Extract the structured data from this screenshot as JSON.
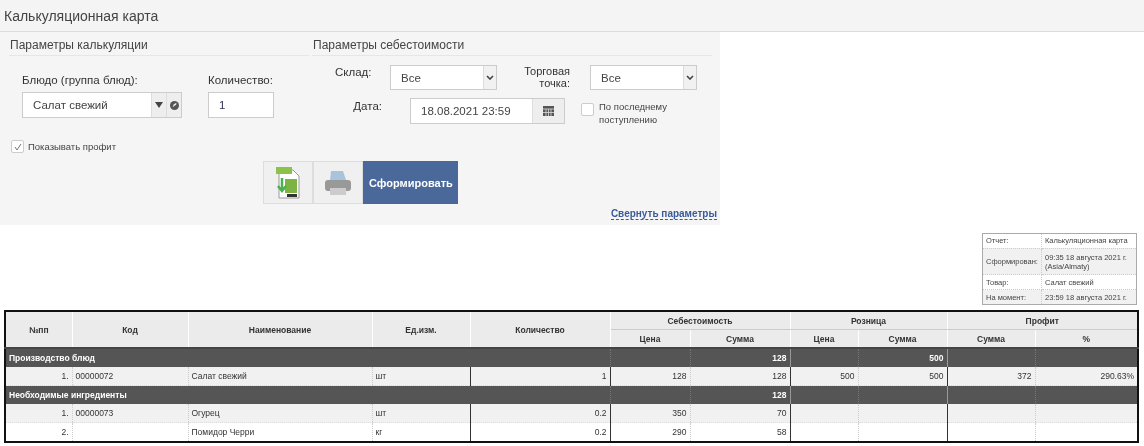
{
  "title": "Калькуляционная карта",
  "calc_params": {
    "heading": "Параметры калькуляции",
    "dish": {
      "label": "Блюдо (группа блюд):",
      "value": "Салат свежий"
    },
    "quantity": {
      "label": "Количество:",
      "value": "1"
    },
    "show_profit": {
      "label": "Показывать профит",
      "checked": true
    }
  },
  "cost_params": {
    "heading": "Параметры себестоимости",
    "warehouse": {
      "label": "Склад:",
      "value": "Все"
    },
    "outlet": {
      "label": "Торговая точка:",
      "value": "Все"
    },
    "date": {
      "label": "Дата:",
      "value": "18.08.2021 23:59"
    },
    "last_receipt": {
      "label": "По последнему поступлению",
      "checked": false
    }
  },
  "actions": {
    "generate": "Сформировать",
    "collapse_link": "Свернуть параметры"
  },
  "report_info": [
    {
      "label": "Отчет:",
      "value": "Калькуляционная карта"
    },
    {
      "label": "Сформирован:",
      "value": "09:35 18 августа 2021 г. (Asia/Almaty)"
    },
    {
      "label": "Товар:",
      "value": "Салат свежий"
    },
    {
      "label": "На момент:",
      "value": "23:59 18 августа 2021 г."
    }
  ],
  "table": {
    "columns": [
      "№пп",
      "Код",
      "Наименование",
      "Ед.изм.",
      "Количество"
    ],
    "groups": [
      {
        "label": "Себестоимость",
        "columns": [
          "Цена",
          "Сумма"
        ]
      },
      {
        "label": "Розница",
        "columns": [
          "Цена",
          "Сумма"
        ]
      },
      {
        "label": "Профит",
        "columns": [
          "Сумма",
          "%"
        ]
      }
    ],
    "rows": [
      {
        "kind": "group",
        "label": "Производство блюд",
        "cost_sum": "128",
        "retail_sum": "500"
      },
      {
        "kind": "item",
        "cells": [
          "1.",
          "00000072",
          "Салат свежий",
          "шт",
          "1",
          "128",
          "128",
          "500",
          "500",
          "372",
          "290.63%"
        ]
      },
      {
        "kind": "group",
        "label": "Необходимые ингредиенты",
        "cost_sum": "128"
      },
      {
        "kind": "item",
        "cells": [
          "1.",
          "00000073",
          "Огурец",
          "шт",
          "0.2",
          "350",
          "70"
        ]
      },
      {
        "kind": "item",
        "cells": [
          "2.",
          null,
          "Помидор Черри",
          "кг",
          "0.2",
          "290",
          "58"
        ]
      }
    ]
  }
}
